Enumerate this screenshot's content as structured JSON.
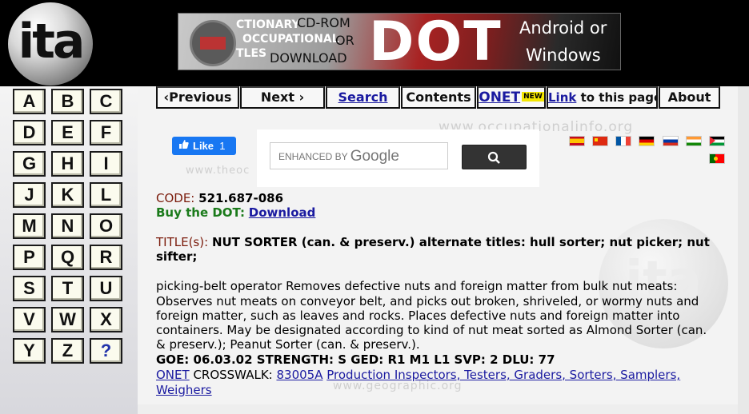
{
  "banner": {
    "logo_text": "ita",
    "left_lines": [
      "CTIONARY",
      "OCCUPATIONAL",
      "TLES"
    ],
    "mid_lines": [
      "CD-ROM",
      "OR",
      "DOWNLOAD"
    ],
    "big_text": "DOT",
    "right_lines": [
      "Android or",
      "Windows"
    ]
  },
  "alphabet": [
    "A",
    "B",
    "C",
    "D",
    "E",
    "F",
    "G",
    "H",
    "I",
    "J",
    "K",
    "L",
    "M",
    "N",
    "O",
    "P",
    "Q",
    "R",
    "S",
    "T",
    "U",
    "V",
    "W",
    "X",
    "Y",
    "Z",
    "?"
  ],
  "nav": {
    "previous": "‹Previous",
    "next": "Next ›",
    "search": "Search",
    "contents": "Contents",
    "onet": "ONET",
    "onet_new": "NEW",
    "link_word": "Link",
    "link_rest": " to this page",
    "about": "About"
  },
  "watermarks": {
    "top": "www.occupationalinfo.org",
    "left": "www.theoc",
    "bottom": "www.geographic.org",
    "circle": "ita"
  },
  "like": {
    "label": "Like",
    "count": "1"
  },
  "search": {
    "enhanced_by": "ENHANCED BY",
    "google": "Google"
  },
  "flags": [
    "es",
    "cn",
    "fr",
    "de",
    "ru",
    "in",
    "ps",
    "pt"
  ],
  "record": {
    "code_label": "CODE:",
    "code_value": "521.687-086",
    "buy_label": "Buy the DOT:",
    "buy_link": "Download",
    "title_label": "TITLE(s):",
    "title_line1": "NUT SORTER (can. & preserv.) alternate titles: hull sorter; nut picker; nut",
    "title_line2": "sifter;",
    "desc_lines": [
      "picking-belt operator Removes defective nuts and foreign matter from bulk nut meats:",
      "Observes nut meats on conveyor belt, and picks out broken, shriveled, or wormy nuts and",
      "foreign matter, such as leaves and rocks. Places defective nuts and foreign matter into",
      "containers. May be designated according to kind of nut meat sorted as Almond Sorter (can.",
      "& preserv.); Peanut Sorter (can. & preserv.)."
    ],
    "goe_line": "GOE: 06.03.02 STRENGTH: S GED: R1 M1 L1 SVP: 2 DLU: 77",
    "onet_link": "ONET",
    "crosswalk_label": " CROSSWALK: ",
    "crosswalk_code": "83005A",
    "crosswalk_title_1": "Production Inspectors, Testers, Graders, Sorters, Samplers,",
    "crosswalk_title_2": "Weighers"
  }
}
